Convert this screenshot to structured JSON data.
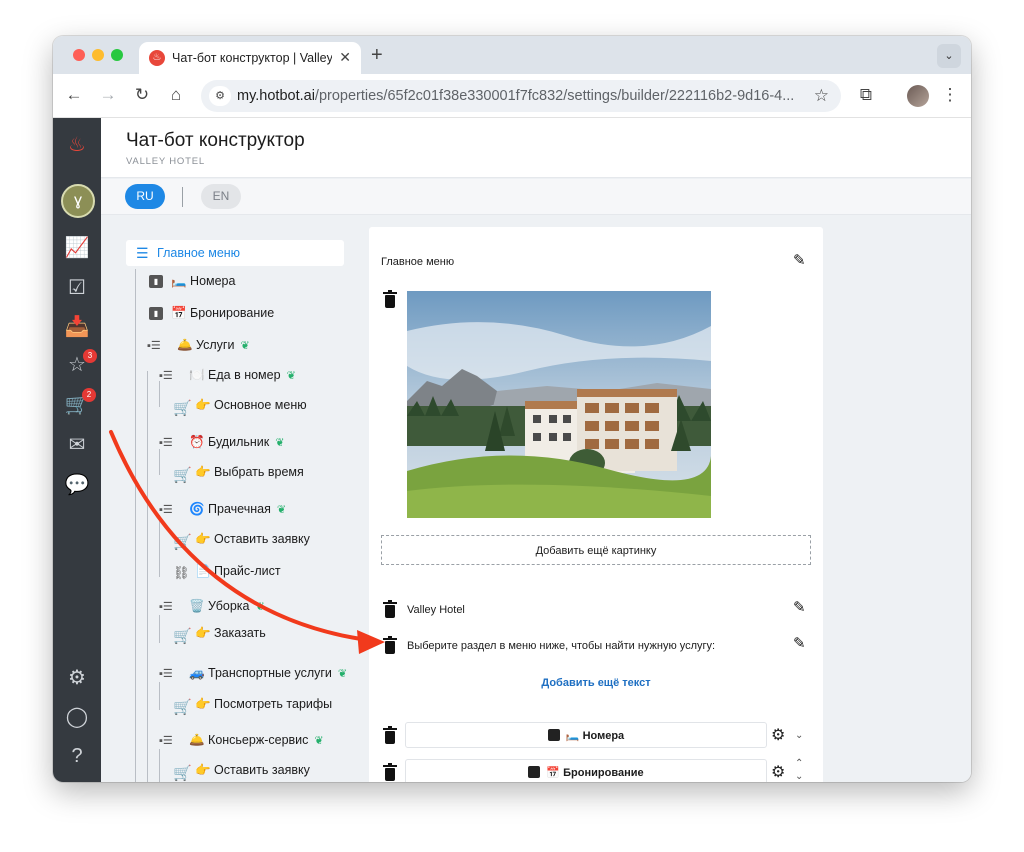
{
  "browser": {
    "tab_title": "Чат-бот конструктор | Valley Hotel",
    "url_host": "my.hotbot.ai",
    "url_path": "/properties/65f2c01f38e330001f7fc832/settings/builder/222116b2-9d16-4..."
  },
  "sidebar": {
    "badges": {
      "reviews": "3",
      "orders": "2"
    },
    "icons": [
      "hotbot-flame-icon",
      "analytics-icon",
      "tasks-icon",
      "inbox-icon",
      "reviews-icon",
      "cart-icon",
      "mail-icon",
      "chat-icon",
      "settings-icon",
      "profile-icon",
      "help-icon"
    ]
  },
  "header": {
    "title": "Чат-бот конструктор",
    "subtitle": "VALLEY HOTEL"
  },
  "languages": {
    "ru": "RU",
    "en": "EN",
    "active": "RU"
  },
  "tree": {
    "root": "Главное меню",
    "nodes": [
      {
        "label": "🛏️ Номера"
      },
      {
        "label": "📅 Бронирование"
      },
      {
        "label": "🛎️ Услуги"
      },
      {
        "label": "🍽️ Еда в номер"
      },
      {
        "label": "👉 Основное меню"
      },
      {
        "label": "⏰ Будильник"
      },
      {
        "label": "👉 Выбрать время"
      },
      {
        "label": "🌀 Прачечная"
      },
      {
        "label": "👉 Оставить заявку"
      },
      {
        "label": "📄 Прайс-лист"
      },
      {
        "label": "🗑️ Уборка"
      },
      {
        "label": "👉 Заказать"
      },
      {
        "label": "🚙 Транспортные услуги"
      },
      {
        "label": "👉 Посмотреть тарифы"
      },
      {
        "label": "🛎️ Консьерж-сервис"
      },
      {
        "label": "👉 Оставить заявку"
      }
    ]
  },
  "content": {
    "title": "Главное меню",
    "add_image": "Добавить ещё картинку",
    "texts": [
      "Valley Hotel",
      "Выберите раздел в меню ниже, чтобы найти нужную услугу:"
    ],
    "add_text": "Добавить ещё текст",
    "buttons": [
      "🛏️ Номера",
      "📅 Бронирование"
    ]
  },
  "colors": {
    "accent": "#1e88e5",
    "sidebar": "#353a40",
    "arrow": "#f13a1c",
    "chat_fab": "#8a8d58"
  }
}
